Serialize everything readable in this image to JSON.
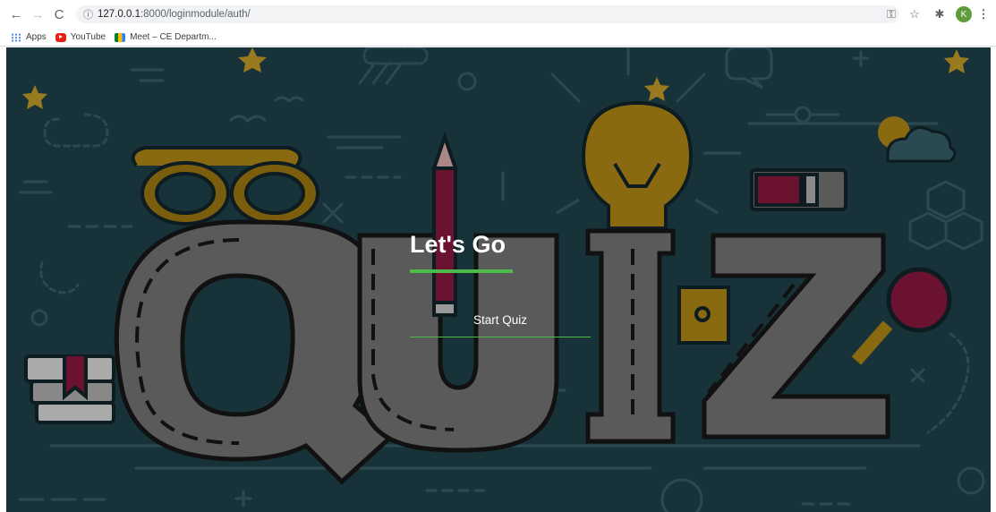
{
  "browser": {
    "url_host": "127.0.0.1",
    "url_rest": ":8000/loginmodule/auth/",
    "profile_initial": "K"
  },
  "bookmarks": [
    {
      "label": "Apps",
      "icon": "apps-grid-icon"
    },
    {
      "label": "YouTube",
      "icon": "youtube-icon"
    },
    {
      "label": "Meet – CE Departm...",
      "icon": "google-meet-icon"
    }
  ],
  "quiz": {
    "heading": "Let's Go",
    "start_label": "Start Quiz",
    "accent_color": "#4cbb4a",
    "background_color": "#173238"
  }
}
